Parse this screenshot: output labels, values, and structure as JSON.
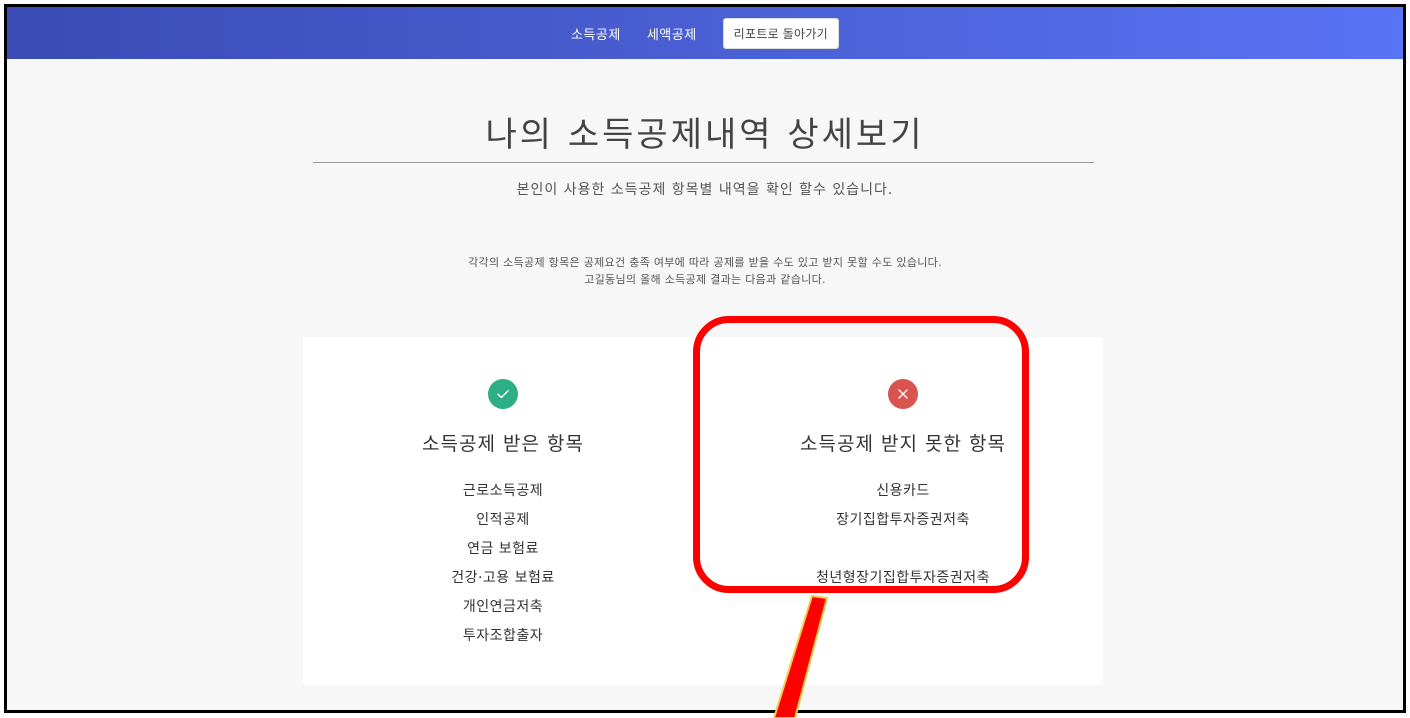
{
  "nav": {
    "income_deduction_label": "소득공제",
    "tax_credit_label": "세액공제",
    "back_to_report_label": "리포트로 돌아가기"
  },
  "header": {
    "title": "나의 소득공제내역 상세보기",
    "subtitle": "본인이 사용한 소득공제 항목별 내역을 확인 할수 있습니다."
  },
  "notice": {
    "line1": "각각의 소득공제 항목은 공제요건 충족 여부에 따라 공제를 받을 수도 있고 받지 못할 수도 있습니다.",
    "line2": "고길동님의 올해 소득공제 결과는 다음과 같습니다."
  },
  "received": {
    "icon": "check-circle-icon",
    "color": "#2eae84",
    "title": "소득공제 받은 항목",
    "items": [
      "근로소득공제",
      "인적공제",
      "연금 보험료",
      "건강·고용 보험료",
      "개인연금저축",
      "투자조합출자"
    ]
  },
  "not_received": {
    "icon": "x-circle-icon",
    "color": "#d9534f",
    "title": "소득공제 받지 못한 항목",
    "items": [
      "신용카드",
      "장기집합투자증권저축",
      "청년형장기집합투자증권저축"
    ]
  },
  "annotation": {
    "highlight_color": "#ff0000"
  }
}
